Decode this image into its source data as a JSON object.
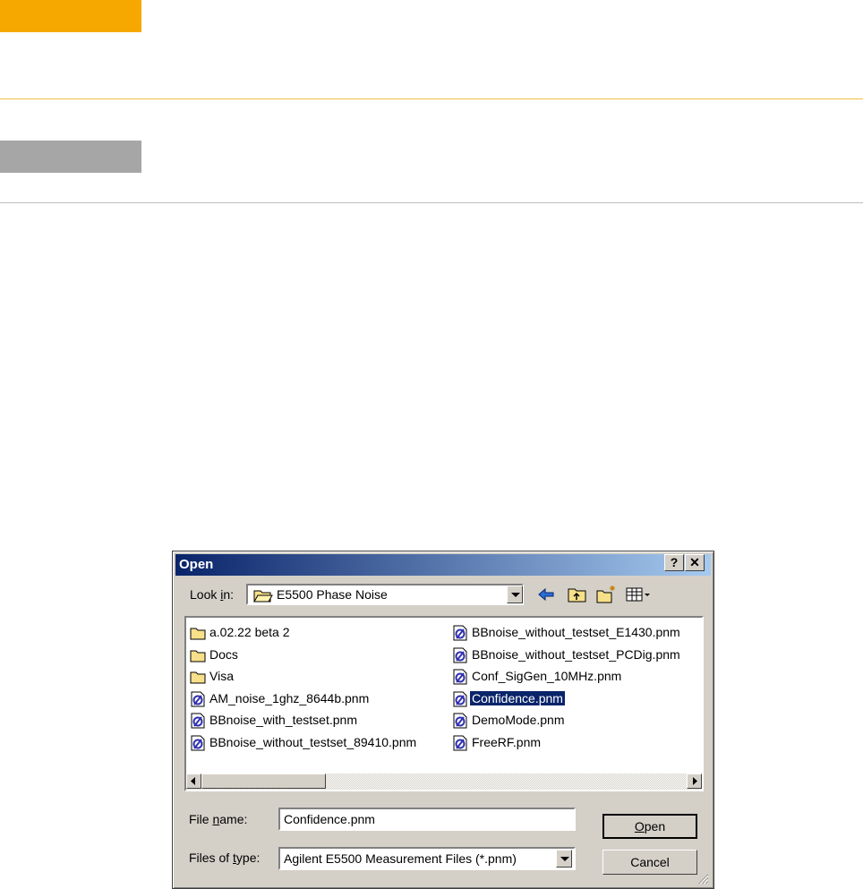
{
  "dialog": {
    "title": "Open",
    "help_label": "?",
    "close_label": "✕",
    "look_in_label": "Look in:",
    "look_in_value": "E5500 Phase Noise",
    "file_name_label": "File name:",
    "file_name_value": "Confidence.pnm",
    "files_of_type_label": "Files of type:",
    "files_of_type_value": "Agilent E5500 Measurement Files (*.pnm)",
    "open_label": "Open",
    "cancel_label": "Cancel",
    "files": [
      {
        "name": "a.02.22 beta 2",
        "type": "folder-icon"
      },
      {
        "name": "Docs",
        "type": "folder-icon"
      },
      {
        "name": "Visa",
        "type": "folder-icon"
      },
      {
        "name": "AM_noise_1ghz_8644b.pnm",
        "type": "pnm-file-icon"
      },
      {
        "name": "BBnoise_with_testset.pnm",
        "type": "pnm-file-icon"
      },
      {
        "name": "BBnoise_without_testset_89410.pnm",
        "type": "pnm-file-icon"
      },
      {
        "name": "BBnoise_without_testset_E1430.pnm",
        "type": "pnm-file-icon"
      },
      {
        "name": "BBnoise_without_testset_PCDig.pnm",
        "type": "pnm-file-icon"
      },
      {
        "name": "Conf_SigGen_10MHz.pnm",
        "type": "pnm-file-icon"
      },
      {
        "name": "Confidence.pnm",
        "type": "pnm-file-icon",
        "selected": true
      },
      {
        "name": "DemoMode.pnm",
        "type": "pnm-file-icon"
      },
      {
        "name": "FreeRF.pnm",
        "type": "pnm-file-icon"
      }
    ]
  },
  "colors": {
    "accent_orange": "#f7a800",
    "accent_gray": "#a6a6a6",
    "titlebar_start": "#0a246a",
    "titlebar_end": "#a6caf0",
    "selection": "#0a246a"
  }
}
